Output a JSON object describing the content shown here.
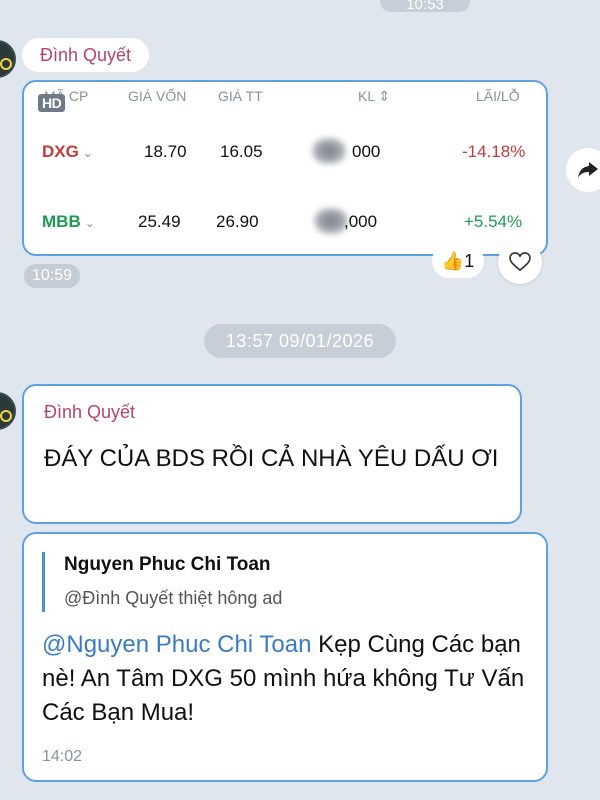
{
  "colors": {
    "sender": "#b5456e",
    "up": "#1f9a53",
    "down": "#c53a3a",
    "accent_border": "#5fa2dd",
    "mention": "#3a7bc8"
  },
  "top_time": "10:53",
  "first_message": {
    "sender": "Đình Quyết",
    "hd_badge": "HD",
    "table": {
      "headers": [
        "MÃ CP",
        "GIÁ VỐN",
        "GIÁ TT",
        "KL",
        "LÃI/LỖ"
      ],
      "kl_sort_icon": "⇕",
      "rows": [
        {
          "code": "DXG",
          "avg_price": "18.70",
          "market_price": "16.05",
          "volume": "000",
          "pnl": "-14.18%"
        },
        {
          "code": "MBB",
          "avg_price": "25.49",
          "market_price": "26.90",
          "volume": ",000",
          "pnl": "+5.54%"
        }
      ]
    },
    "time": "10:59",
    "reaction_count": "1",
    "reaction_icon": "thumbs-up-icon"
  },
  "date_separator": "13:57 09/01/2026",
  "second_message": {
    "sender": "Đình Quyết",
    "text": "ĐÁY CỦA BDS RỒI CẢ NHÀ YÊU DẤU ƠI"
  },
  "reply_message": {
    "quote_name": "Nguyen Phuc Chi Toan",
    "quote_text": "@Đình Quyết thiệt hông ad",
    "mention": "@Nguyen Phuc Chi Toan",
    "text": " Kẹp Cùng Các bạn nè! An Tâm DXG 50 mình hứa không Tư Vấn Các Bạn Mua!",
    "time": "14:02"
  }
}
